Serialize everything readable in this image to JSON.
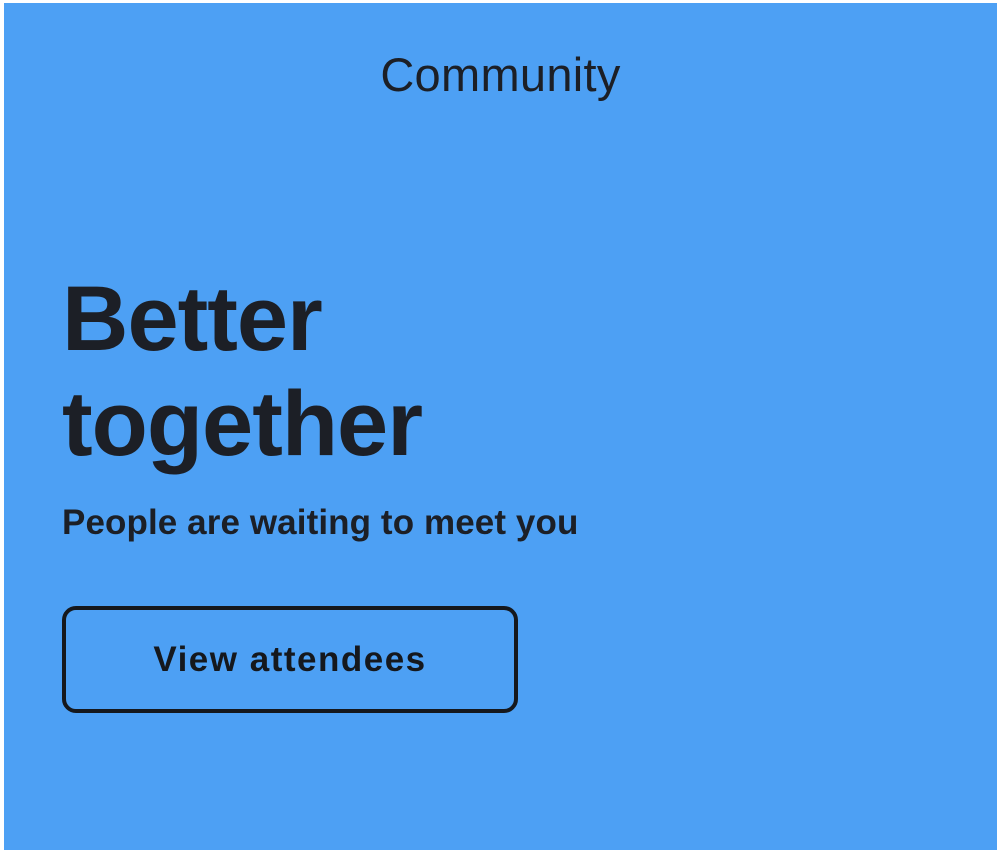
{
  "header": {
    "title": "Community"
  },
  "hero": {
    "headline_line1": "Better",
    "headline_line2": "together",
    "subtitle": "People are waiting to meet you",
    "cta_label": "View attendees"
  },
  "colors": {
    "background": "#4da0f4",
    "text": "#1c1f26"
  }
}
